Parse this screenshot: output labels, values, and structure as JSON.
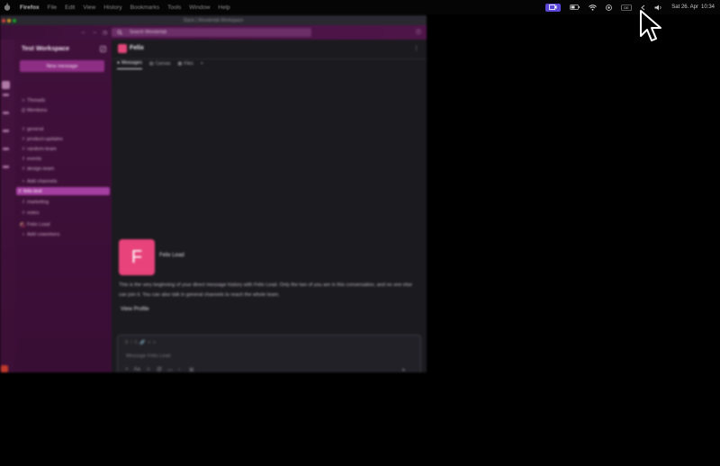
{
  "menubar": {
    "items": [
      "Firefox",
      "File",
      "Edit",
      "View",
      "History",
      "Bookmarks",
      "Tools",
      "Window",
      "Help"
    ],
    "status": {
      "active_badge_color": "#5b47d6",
      "keyboard_label": "DE",
      "date_label": "Sat 26. Apr",
      "time_label": "10:34",
      "icons": [
        "screen-record-icon",
        "battery-icon",
        "wifi-icon",
        "control-center-icon",
        "keyboard-icon",
        "chevron-icon",
        "volume-icon"
      ]
    }
  },
  "window": {
    "title": "Slack | Wonderlab Workspace",
    "toolbar": {
      "search_placeholder": "Search Wonderlab",
      "help_icon": "help-icon"
    },
    "sidebar": {
      "workspace_name": "Test Workspace",
      "new_message_label": "New message",
      "items": [
        {
          "glyph": "≡",
          "label": "Threads"
        },
        {
          "glyph": "@",
          "label": "Mentions"
        },
        {
          "glyph": "#",
          "label": "general"
        },
        {
          "glyph": "#",
          "label": "product-updates"
        },
        {
          "glyph": "#",
          "label": "random-team"
        },
        {
          "glyph": "#",
          "label": "events"
        },
        {
          "glyph": "#",
          "label": "design-team"
        },
        {
          "glyph": "+",
          "label": "Add channels"
        },
        {
          "glyph": "#",
          "label": "felix-test",
          "active": true
        },
        {
          "glyph": "#",
          "label": "marketing"
        },
        {
          "glyph": "#",
          "label": "notes"
        },
        {
          "glyph": "●",
          "label": "Felix Lead"
        },
        {
          "glyph": "+",
          "label": "Add coworkers"
        }
      ]
    },
    "channel": {
      "name": "Felix",
      "tabs": [
        "Messages",
        "Canvas",
        "Files"
      ],
      "intro_initial": "F",
      "intro_name": "Felix Lead",
      "intro_text": "This is the very beginning of your direct message history with Felix Lead. Only the two of you are in this conversation, and no one else can join it. You can also talk in general channels to reach the whole team.",
      "intro_link": "View Profile",
      "composer_placeholder": "Message Felix Lead",
      "accent_color": "#e8437a"
    }
  }
}
